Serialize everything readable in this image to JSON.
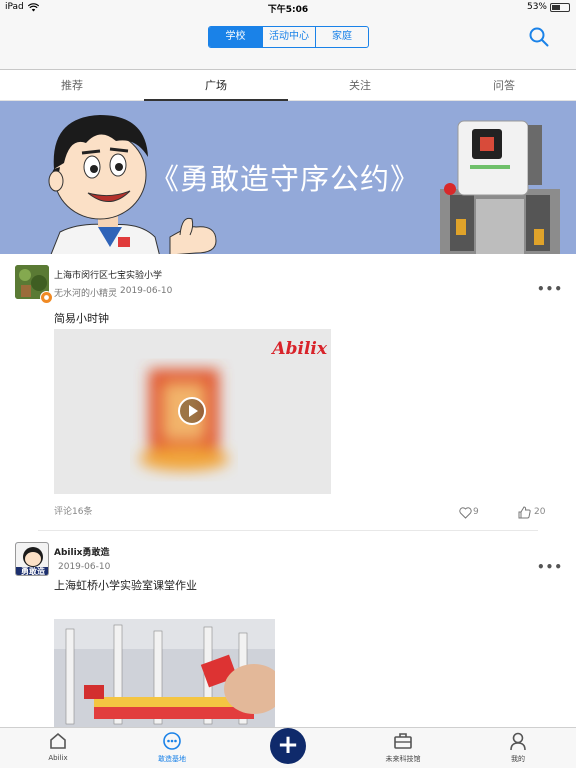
{
  "status": {
    "device": "iPad",
    "time": "下午5:06",
    "battery": "53%",
    "battery_level": 0.53
  },
  "nav": {
    "segments": [
      {
        "label": "学校",
        "active": true
      },
      {
        "label": "活动中心",
        "active": false
      },
      {
        "label": "家庭",
        "active": false
      }
    ]
  },
  "tabs": [
    {
      "label": "推荐",
      "active": false
    },
    {
      "label": "广场",
      "active": true
    },
    {
      "label": "关注",
      "active": false
    },
    {
      "label": "问答",
      "active": false
    }
  ],
  "banner": {
    "title": "《勇敢造守序公约》"
  },
  "posts": [
    {
      "author": "上海市闵行区七宝实验小学",
      "subname": "无水河的小精灵",
      "date": "2019-06-10",
      "title": "简易小时钟",
      "video_brand": "Abilix",
      "comments": "评论16条",
      "likes": "9",
      "thumbs": "20"
    },
    {
      "author": "Abilix勇敢造",
      "date": "2019-06-10",
      "title": "上海虹桥小学实验室课堂作业",
      "avatar_text": "勇敢造"
    }
  ],
  "tabbar": {
    "items": [
      {
        "label": "Abilix"
      },
      {
        "label": "敢造基地",
        "active": true
      },
      {
        "label": "未来科技馆"
      },
      {
        "label": "我的"
      }
    ],
    "plus_label": "+"
  },
  "colors": {
    "accent": "#1a82e8",
    "banner": "#93a9d9",
    "plus": "#0f2a6b"
  }
}
